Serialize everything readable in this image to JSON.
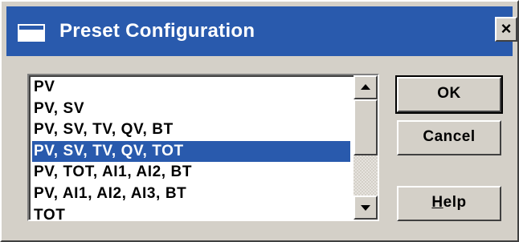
{
  "window": {
    "title": "Preset Configuration",
    "close_label": "×"
  },
  "preset_list": {
    "items": [
      "PV",
      "PV, SV",
      "PV, SV, TV, QV, BT",
      "PV, SV, TV, QV, TOT",
      "PV, TOT, AI1, AI2, BT",
      "PV, AI1, AI2, AI3, BT",
      "TOT"
    ],
    "selected_index": 3
  },
  "scrollbar": {
    "up_icon": "arrow-up-icon",
    "down_icon": "arrow-down-icon"
  },
  "buttons": {
    "ok": "OK",
    "cancel": "Cancel",
    "help_prefix": "H",
    "help_rest": "elp"
  },
  "colors": {
    "titlebar": "#295aad",
    "selection": "#295aad",
    "face": "#d4d0c8"
  }
}
